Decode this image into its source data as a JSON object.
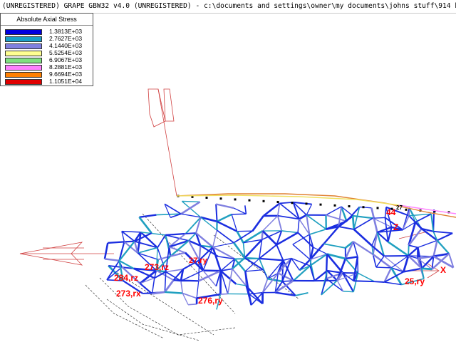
{
  "window": {
    "title": "(UNREGISTERED) GRAPE GBW32 v4.0 (UNREGISTERED)  - c:\\documents and settings\\owner\\my documents\\johns stuff\\914 base model - (F"
  },
  "legend": {
    "title": "Absolute Axial Stress",
    "entries": [
      {
        "value": "1.3813E+03",
        "color": "#0000e0"
      },
      {
        "value": "2.7627E+03",
        "color": "#1aa0c8"
      },
      {
        "value": "4.1440E+03",
        "color": "#8080e0"
      },
      {
        "value": "5.5254E+03",
        "color": "#ffff90"
      },
      {
        "value": "6.9067E+03",
        "color": "#80e080"
      },
      {
        "value": "8.2881E+03",
        "color": "#ff80ff"
      },
      {
        "value": "9.6694E+03",
        "color": "#ff8000"
      },
      {
        "value": "1.1051E+04",
        "color": "#e00000"
      }
    ]
  },
  "model_labels": {
    "node_273_rz": "273,rz",
    "node_273_rx": "273,rx",
    "node_284_rz": "284,rz",
    "node_276_ry": "276,ry",
    "node_27_y": "27,ry",
    "node_25_ry": "25,ry",
    "node_44": "44",
    "node_27_top": "27",
    "axis_x": "X",
    "axis_z": "Z"
  },
  "colors": {
    "member_primary": "#1b2ee0",
    "member_secondary": "#20a0c0",
    "support_arrows": "#d04040",
    "label_red": "#ff0000"
  }
}
